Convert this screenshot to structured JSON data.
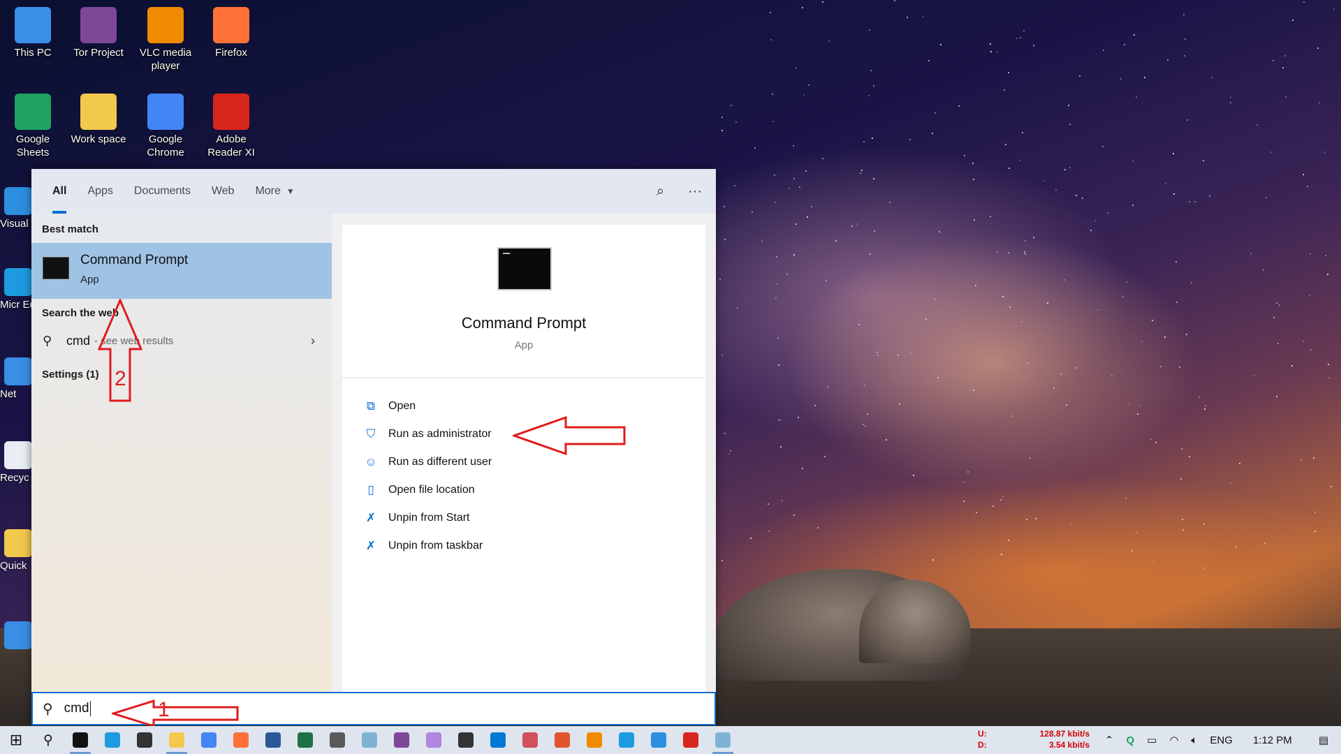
{
  "desktop": {
    "icons": [
      {
        "label": "This PC",
        "icon": "computer-icon",
        "color": "#3a8ee6"
      },
      {
        "label": "Tor Project",
        "icon": "tor-icon",
        "color": "#7e4798"
      },
      {
        "label": "VLC media player",
        "icon": "vlc-icon",
        "color": "#f08a00"
      },
      {
        "label": "Firefox",
        "icon": "firefox-icon",
        "color": "#ff7139"
      },
      {
        "label": "Google Sheets",
        "icon": "sheets-icon",
        "color": "#1ea362"
      },
      {
        "label": "Work space",
        "icon": "folder-icon",
        "color": "#f2c94c"
      },
      {
        "label": "Google Chrome",
        "icon": "chrome-icon",
        "color": "#4285f4"
      },
      {
        "label": "Adobe Reader XI",
        "icon": "acrobat-icon",
        "color": "#d9261c"
      }
    ],
    "partial_icons": [
      {
        "label": "Visual Co",
        "icon": "vscode-icon",
        "color": "#2d8fe0"
      },
      {
        "label": "Micr Ed",
        "icon": "edge-icon",
        "color": "#1e9be0"
      },
      {
        "label": "Net",
        "icon": "network-icon",
        "color": "#3a8ee6"
      },
      {
        "label": "Recyc",
        "icon": "recycle-bin-icon",
        "color": "#e8eef4"
      },
      {
        "label": "Quick",
        "icon": "folder-icon",
        "color": "#f2c94c"
      },
      {
        "label": "",
        "icon": "control-panel-icon",
        "color": "#3a8ee6"
      }
    ]
  },
  "search": {
    "tabs": [
      {
        "label": "All",
        "active": true
      },
      {
        "label": "Apps",
        "active": false
      },
      {
        "label": "Documents",
        "active": false
      },
      {
        "label": "Web",
        "active": false
      },
      {
        "label": "More",
        "active": false
      }
    ],
    "best_match_label": "Best match",
    "best_match": {
      "title": "Command Prompt",
      "subtitle": "App"
    },
    "search_web_label": "Search the web",
    "web_result": {
      "query": "cmd",
      "hint": "- see web results"
    },
    "settings_label": "Settings (1)",
    "preview": {
      "title": "Command Prompt",
      "subtitle": "App"
    },
    "actions": [
      {
        "label": "Open",
        "icon": "open-icon"
      },
      {
        "label": "Run as administrator",
        "icon": "shield-icon"
      },
      {
        "label": "Run as different user",
        "icon": "user-icon"
      },
      {
        "label": "Open file location",
        "icon": "file-location-icon"
      },
      {
        "label": "Unpin from Start",
        "icon": "unpin-icon"
      },
      {
        "label": "Unpin from taskbar",
        "icon": "unpin-icon"
      }
    ],
    "query_value": "cmd"
  },
  "annotations": {
    "arrow1": "1",
    "arrow2": "2",
    "color": "#e01c1c"
  },
  "taskbar": {
    "apps": [
      {
        "name": "cmd",
        "color": "#111111"
      },
      {
        "name": "ie",
        "color": "#1e9be0"
      },
      {
        "name": "store",
        "color": "#333333"
      },
      {
        "name": "explorer",
        "color": "#f2c94c"
      },
      {
        "name": "chrome",
        "color": "#4285f4"
      },
      {
        "name": "firefox",
        "color": "#ff7139"
      },
      {
        "name": "word",
        "color": "#2b5797"
      },
      {
        "name": "excel",
        "color": "#1e7145"
      },
      {
        "name": "calculator",
        "color": "#5a5a5a"
      },
      {
        "name": "paint",
        "color": "#7fb3d5"
      },
      {
        "name": "tor",
        "color": "#7e4798"
      },
      {
        "name": "paint3d",
        "color": "#b084e0"
      },
      {
        "name": "photos",
        "color": "#333333"
      },
      {
        "name": "skype",
        "color": "#0078d4"
      },
      {
        "name": "snip",
        "color": "#d0505c"
      },
      {
        "name": "app",
        "color": "#e05530"
      },
      {
        "name": "vlc",
        "color": "#f08a00"
      },
      {
        "name": "edge",
        "color": "#1e9be0"
      },
      {
        "name": "vscode",
        "color": "#2d8fe0"
      },
      {
        "name": "acrobat",
        "color": "#d9261c"
      },
      {
        "name": "notepad",
        "color": "#7fb3d5"
      }
    ],
    "net": {
      "up_label": "U:",
      "up_value": "128.87 kbit/s",
      "down_label": "D:",
      "down_value": "3.54 kbit/s"
    },
    "tray": {
      "lang": "ENG",
      "time": "1:12 PM"
    }
  }
}
